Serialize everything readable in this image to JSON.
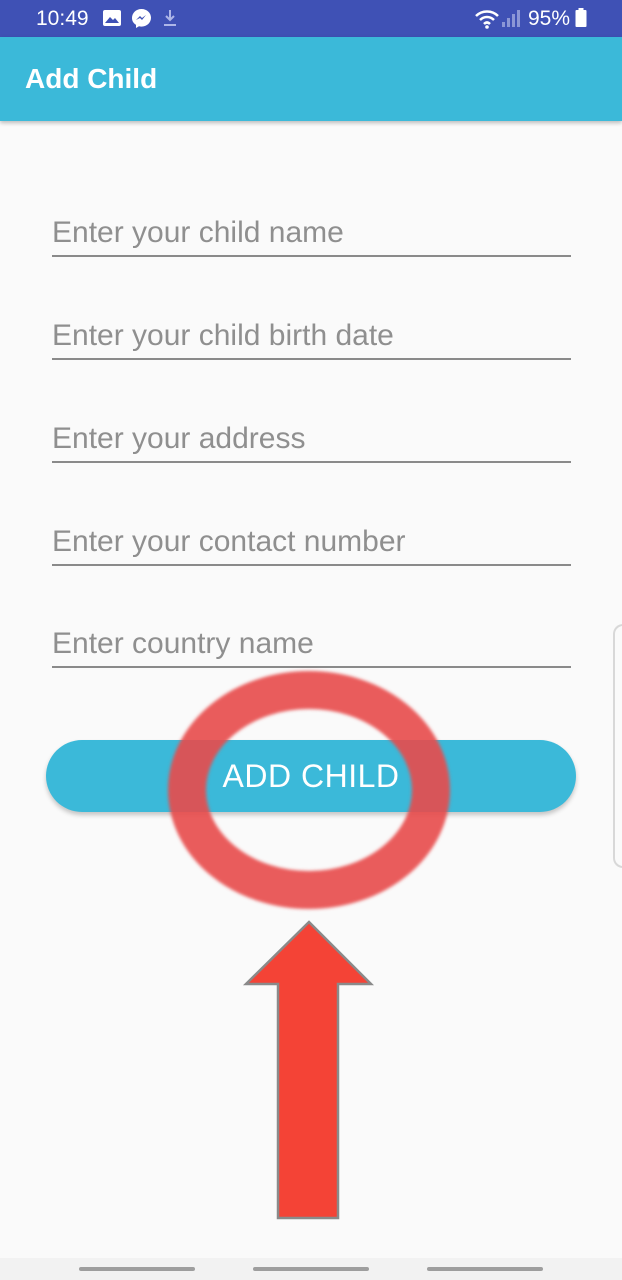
{
  "status_bar": {
    "time": "10:49",
    "battery_percent": "95%",
    "icons": [
      "image-icon",
      "messenger-icon",
      "download-icon",
      "wifi-icon",
      "signal-icon",
      "battery-icon"
    ]
  },
  "app_bar": {
    "title": "Add Child"
  },
  "form": {
    "child_name_placeholder": "Enter your child name",
    "birth_date_placeholder": "Enter your child birth date",
    "address_placeholder": "Enter your address",
    "contact_placeholder": "Enter your contact number",
    "country_placeholder": "Enter country name",
    "submit_label": "ADD CHILD"
  },
  "annotation": {
    "circle_color": "#e84b4b",
    "arrow_color": "#f44336"
  },
  "colors": {
    "status_bar": "#3f51b5",
    "primary": "#3bb9d9",
    "background": "#fafafa"
  }
}
